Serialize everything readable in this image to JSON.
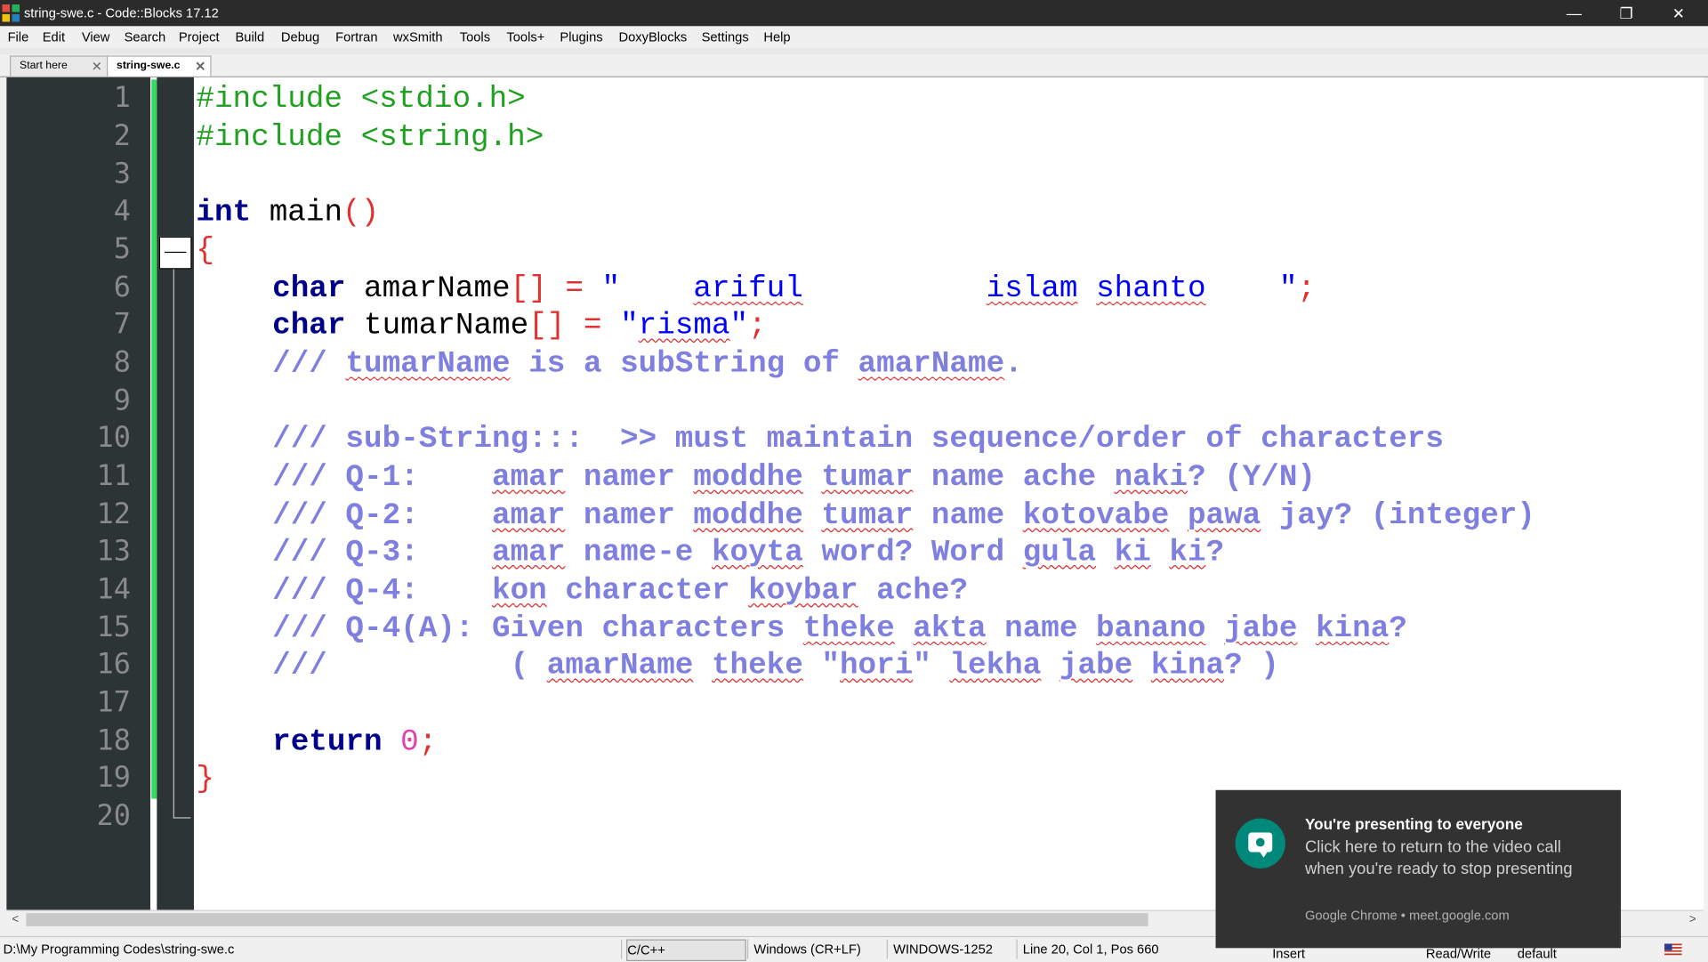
{
  "window": {
    "title": "string-swe.c - Code::Blocks 17.12",
    "minimize": "—",
    "restore": "❐",
    "close": "✕"
  },
  "menu": [
    "File",
    "Edit",
    "View",
    "Search",
    "Project",
    "Build",
    "Debug",
    "Fortran",
    "wxSmith",
    "Tools",
    "Tools+",
    "Plugins",
    "DoxyBlocks",
    "Settings",
    "Help"
  ],
  "tabs": [
    {
      "label": "Start here",
      "active": false
    },
    {
      "label": "string-swe.c",
      "active": true
    }
  ],
  "line_numbers": [
    "1",
    "2",
    "3",
    "4",
    "5",
    "6",
    "7",
    "8",
    "9",
    "10",
    "11",
    "12",
    "13",
    "14",
    "15",
    "16",
    "17",
    "18",
    "19",
    "20"
  ],
  "code": {
    "l1": "#include <stdio.h>",
    "l2": "#include <string.h>",
    "l4_kw": "int",
    "l4_rest": " main",
    "l4_paren": "()",
    "l5": "{",
    "l6_kw": "char",
    "l6_id": " amarName",
    "l6_br": "[]",
    "l6_eq": " = ",
    "l6_q1": "\"    ",
    "l6_w1": "ariful",
    "l6_sp": "          ",
    "l6_w2": "islam",
    "l6_sp2": " ",
    "l6_w3": "shanto",
    "l6_q2": "    \"",
    "l6_semi": ";",
    "l7_kw": "char",
    "l7_id": " tumarName",
    "l7_br": "[]",
    "l7_eq": " = ",
    "l7_q1": "\"",
    "l7_w1": "risma",
    "l7_q2": "\"",
    "l7_semi": ";",
    "l8_a": "/// ",
    "l8_w1": "tumarName",
    "l8_b": " is a subString of ",
    "l8_w2": "amarName",
    "l8_c": ".",
    "l10": "/// sub-String:::  >> must maintain sequence/order of characters",
    "l11_a": "/// Q-1:    ",
    "l11_w1": "amar",
    "l11_b": " namer ",
    "l11_w2": "moddhe",
    "l11_c": " ",
    "l11_w3": "tumar",
    "l11_d": " name ache ",
    "l11_w4": "naki",
    "l11_e": "? (Y/N)",
    "l12_a": "/// Q-2:    ",
    "l12_w1": "amar",
    "l12_b": " namer ",
    "l12_w2": "moddhe",
    "l12_c": " ",
    "l12_w3": "tumar",
    "l12_d": " name ",
    "l12_w4": "kotovabe",
    "l12_e": " ",
    "l12_w5": "pawa",
    "l12_f": " jay? (integer)",
    "l13_a": "/// Q-3:    ",
    "l13_w1": "amar",
    "l13_b": " name-e ",
    "l13_w2": "koyta",
    "l13_c": " word? Word ",
    "l13_w3": "gula",
    "l13_d": " ",
    "l13_w4": "ki",
    "l13_e": " ",
    "l13_w5": "ki",
    "l13_f": "?",
    "l14_a": "/// Q-4:    ",
    "l14_w1": "kon",
    "l14_b": " character ",
    "l14_w2": "koybar",
    "l14_c": " ache?",
    "l15_a": "/// Q-4(A): Given characters ",
    "l15_w1": "theke",
    "l15_b": " ",
    "l15_w2": "akta",
    "l15_c": " name ",
    "l15_w3": "banano",
    "l15_d": " ",
    "l15_w4": "jabe",
    "l15_e": " ",
    "l15_w5": "kina",
    "l15_f": "?",
    "l16_a": "///          ( ",
    "l16_w1": "amarName",
    "l16_b": " ",
    "l16_w2": "theke",
    "l16_c": " \"",
    "l16_w3": "hori",
    "l16_d": "\" ",
    "l16_w4": "lekha",
    "l16_e": " ",
    "l16_w5": "jabe",
    "l16_f": " ",
    "l16_w6": "kina",
    "l16_g": "? )",
    "l18_kw": "return",
    "l18_sp": " ",
    "l18_num": "0",
    "l18_semi": ";",
    "l19": "}"
  },
  "status": {
    "path": "D:\\My Programming Codes\\string-swe.c",
    "lang": "C/C++",
    "eol": "Windows (CR+LF)",
    "encoding": "WINDOWS-1252",
    "position": "Line 20, Col 1, Pos 660",
    "mode": "Insert",
    "access": "Read/Write",
    "theme": "default"
  },
  "toast": {
    "title": "You're presenting to everyone",
    "body": "Click here to return to the video call when you're ready to stop presenting",
    "source": "Google Chrome • meet.google.com"
  },
  "scroll_arrows": {
    "left": "<",
    "right": ">"
  }
}
